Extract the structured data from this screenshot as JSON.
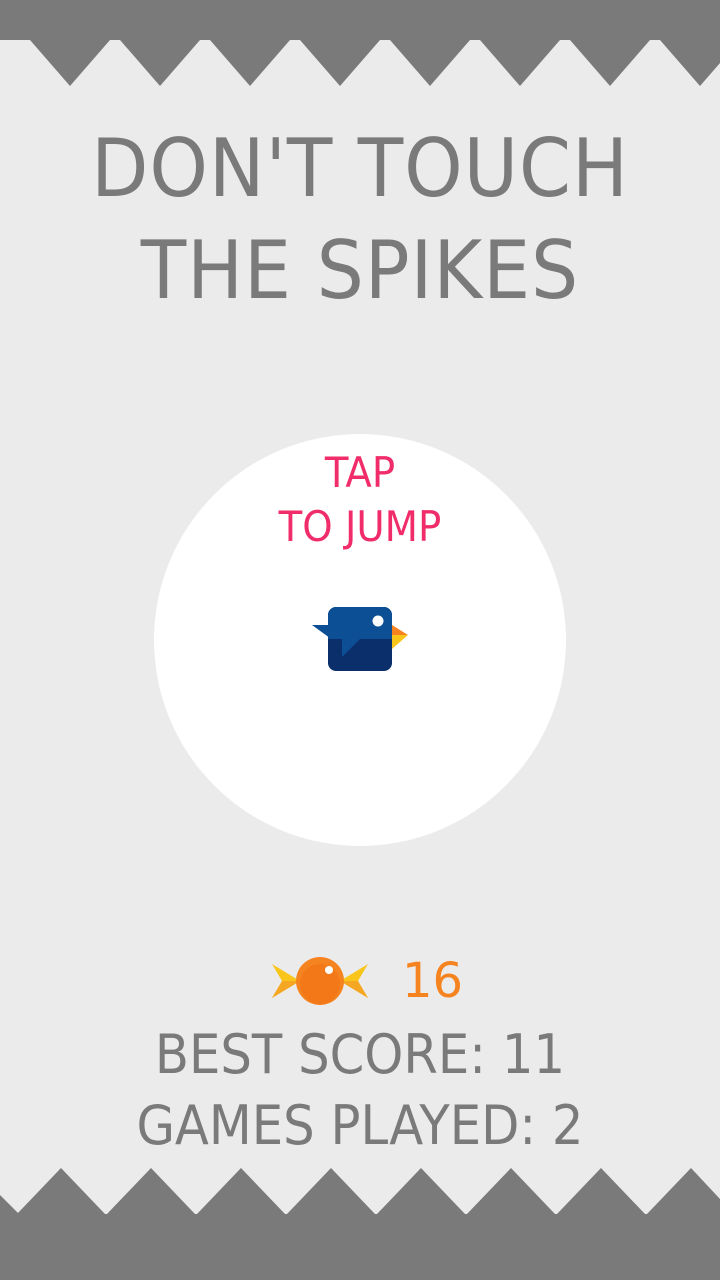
{
  "game": {
    "title_line1": "DON'T TOUCH",
    "title_line2": "THE SPIKES",
    "prompt_line1": "TAP",
    "prompt_line2": "TO JUMP",
    "candy_count": "16",
    "best_score_text": "BEST SCORE: 11",
    "games_played_text": "GAMES PLAYED: 2"
  },
  "colors": {
    "background": "#ebebeb",
    "spikes": "#7a7a7a",
    "title": "#7a7a7a",
    "prompt": "#f02d6a",
    "candy_count": "#f5831f",
    "bird_body": "#0b2f6b",
    "bird_top": "#0d4f95",
    "bird_beak": "#f5831f"
  },
  "icons": {
    "bird": "bird-character-icon",
    "candy": "candy-icon"
  }
}
